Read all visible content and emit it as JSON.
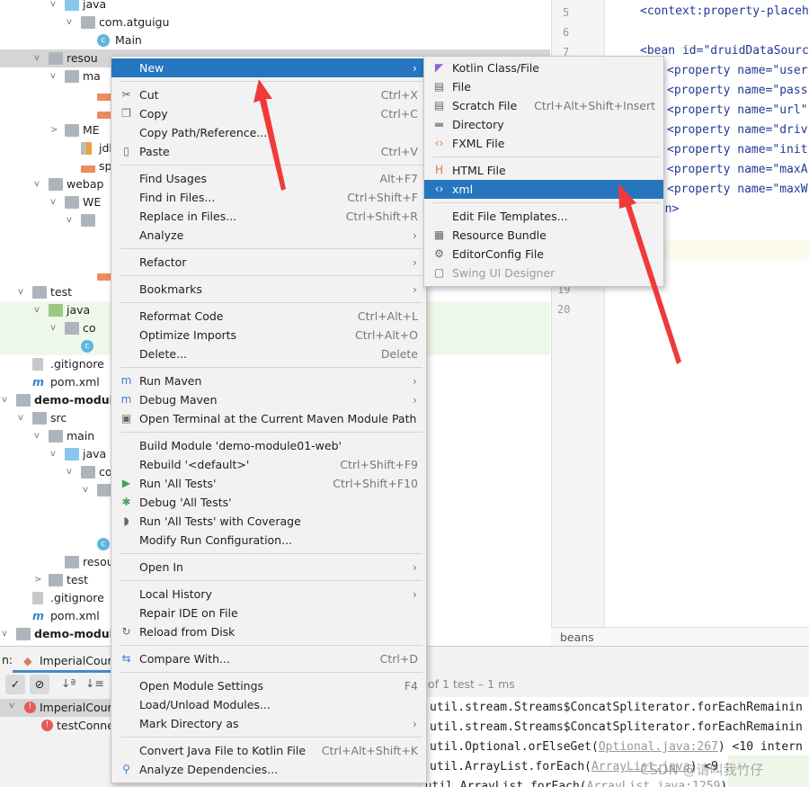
{
  "tree": [
    {
      "label": "java",
      "depth": 3,
      "open": true,
      "icon": "java-folder-icon"
    },
    {
      "label": "com.atguigu",
      "depth": 4,
      "open": true,
      "icon": "package-icon"
    },
    {
      "label": "Main",
      "depth": 5,
      "icon": "java-class-icon"
    },
    {
      "label": "resou",
      "depth": 2,
      "open": true,
      "icon": "resources-folder-icon",
      "selected": true
    },
    {
      "label": "ma",
      "depth": 3,
      "open": true,
      "icon": "folder-icon"
    },
    {
      "label": "",
      "depth": 5,
      "icon": "xml-file-icon"
    },
    {
      "label": "",
      "depth": 5,
      "icon": "xml-file-icon"
    },
    {
      "label": "ME",
      "depth": 3,
      "open": false,
      "icon": "folder-icon"
    },
    {
      "label": "jdb",
      "depth": 4,
      "icon": "properties-file-icon"
    },
    {
      "label": "sp",
      "depth": 4,
      "icon": "xml-file-icon"
    },
    {
      "label": "webap",
      "depth": 2,
      "open": true,
      "icon": "folder-icon"
    },
    {
      "label": "WE",
      "depth": 3,
      "open": true,
      "icon": "folder-icon"
    },
    {
      "label": "",
      "depth": 4,
      "open": true,
      "icon": "folder-icon"
    },
    null,
    null,
    {
      "label": "",
      "depth": 5,
      "icon": "xml-file-icon"
    },
    {
      "label": "test",
      "depth": 1,
      "open": true,
      "icon": "folder-icon"
    },
    {
      "label": "java",
      "depth": 2,
      "open": true,
      "icon": "test-folder-icon",
      "green": true
    },
    {
      "label": "co",
      "depth": 3,
      "open": true,
      "icon": "package-icon",
      "green": true
    },
    {
      "label": "",
      "depth": 4,
      "icon": "java-class-icon",
      "green": true
    },
    {
      "label": ".gitignore",
      "depth": 1,
      "icon": "gitignore-icon"
    },
    {
      "label": "pom.xml",
      "depth": 1,
      "icon": "maven-icon"
    },
    {
      "label": "demo-module",
      "depth": 0,
      "open": true,
      "icon": "module-icon",
      "bold": true
    },
    {
      "label": "src",
      "depth": 1,
      "open": true,
      "icon": "folder-icon"
    },
    {
      "label": "main",
      "depth": 2,
      "open": true,
      "icon": "folder-icon"
    },
    {
      "label": "java",
      "depth": 3,
      "open": true,
      "icon": "java-folder-icon"
    },
    {
      "label": "co",
      "depth": 4,
      "open": true,
      "icon": "package-icon"
    },
    {
      "label": "",
      "depth": 5,
      "open": true,
      "icon": "package-icon"
    },
    null,
    null,
    {
      "label": "",
      "depth": 5,
      "icon": "java-class-icon"
    },
    {
      "label": "resou",
      "depth": 3,
      "icon": "resources-folder-icon"
    },
    {
      "label": "test",
      "depth": 2,
      "open": false,
      "icon": "folder-icon"
    },
    {
      "label": ".gitignore",
      "depth": 1,
      "icon": "gitignore-icon"
    },
    {
      "label": "pom.xml",
      "depth": 1,
      "icon": "maven-icon"
    },
    {
      "label": "demo-module",
      "depth": 0,
      "open": true,
      "icon": "module-icon",
      "bold": true
    }
  ],
  "editor": {
    "line_numbers": [
      "5",
      "6",
      "7",
      "19",
      "20"
    ],
    "lines": [
      {
        "text": "<context:property-placeh"
      },
      {
        "text": "<bean id=\"druidDataSourc"
      },
      {
        "text": "<property name=\"user"
      },
      {
        "text": "<property name=\"pass"
      },
      {
        "text": "<property name=\"url\""
      },
      {
        "text": "<property name=\"driv"
      },
      {
        "text": "<property name=\"init"
      },
      {
        "text": "<property name=\"maxA"
      },
      {
        "text": "<property name=\"maxW"
      },
      {
        "text": "ean>"
      },
      {
        "text": ">"
      }
    ],
    "breadcrumb": "beans"
  },
  "bottom": {
    "tab_prefix": "n:",
    "tab": "ImperialCourt",
    "summary": "of 1 test – 1 ms",
    "tests": [
      "ImperialCour",
      "testConne"
    ],
    "console": [
      {
        "code": "util.stream.Streams$ConcatSpliterator.forEachRemainin",
        "link": "",
        "rest": ""
      },
      {
        "code": "util.stream.Streams$ConcatSpliterator.forEachRemainin",
        "link": "",
        "rest": ""
      },
      {
        "code": "util.Optional.orElseGet(",
        "link": "Optional.java:267",
        "rest": ") <10 intern"
      },
      {
        "code": "util.ArrayList.forEach(",
        "link": "ArrayList.java",
        "rest": ") <9 intern"
      },
      {
        "code": "at java.util.ArrayList.forEach(",
        "link": "ArrayList.java:1259",
        "rest": ") <25 intern"
      }
    ]
  },
  "watermark": "CSDN @请叫我竹仔",
  "context_menu": [
    {
      "label": "New",
      "submenu": true,
      "highlight": true
    },
    {
      "sep": true
    },
    {
      "label": "Cut",
      "shortcut": "Ctrl+X",
      "icon": "scissors-icon"
    },
    {
      "label": "Copy",
      "shortcut": "Ctrl+C",
      "icon": "copy-icon"
    },
    {
      "label": "Copy Path/Reference..."
    },
    {
      "label": "Paste",
      "shortcut": "Ctrl+V",
      "icon": "clipboard-icon"
    },
    {
      "sep": true
    },
    {
      "label": "Find Usages",
      "shortcut": "Alt+F7"
    },
    {
      "label": "Find in Files...",
      "shortcut": "Ctrl+Shift+F"
    },
    {
      "label": "Replace in Files...",
      "shortcut": "Ctrl+Shift+R"
    },
    {
      "label": "Analyze",
      "submenu": true
    },
    {
      "sep": true
    },
    {
      "label": "Refactor",
      "submenu": true
    },
    {
      "sep": true
    },
    {
      "label": "Bookmarks",
      "submenu": true
    },
    {
      "sep": true
    },
    {
      "label": "Reformat Code",
      "shortcut": "Ctrl+Alt+L"
    },
    {
      "label": "Optimize Imports",
      "shortcut": "Ctrl+Alt+O"
    },
    {
      "label": "Delete...",
      "shortcut": "Delete"
    },
    {
      "sep": true
    },
    {
      "label": "Run Maven",
      "submenu": true,
      "icon": "maven-run-icon"
    },
    {
      "label": "Debug Maven",
      "submenu": true,
      "icon": "maven-debug-icon"
    },
    {
      "label": "Open Terminal at the Current Maven Module Path",
      "icon": "terminal-icon"
    },
    {
      "sep": true
    },
    {
      "label": "Build Module 'demo-module01-web'"
    },
    {
      "label": "Rebuild '<default>'",
      "shortcut": "Ctrl+Shift+F9"
    },
    {
      "label": "Run 'All Tests'",
      "shortcut": "Ctrl+Shift+F10",
      "icon": "run-icon"
    },
    {
      "label": "Debug 'All Tests'",
      "icon": "debug-icon"
    },
    {
      "label": "Run 'All Tests' with Coverage",
      "icon": "coverage-icon"
    },
    {
      "label": "Modify Run Configuration..."
    },
    {
      "sep": true
    },
    {
      "label": "Open In",
      "submenu": true
    },
    {
      "sep": true
    },
    {
      "label": "Local History",
      "submenu": true
    },
    {
      "label": "Repair IDE on File"
    },
    {
      "label": "Reload from Disk",
      "icon": "reload-icon"
    },
    {
      "sep": true
    },
    {
      "label": "Compare With...",
      "shortcut": "Ctrl+D",
      "icon": "compare-icon"
    },
    {
      "sep": true
    },
    {
      "label": "Open Module Settings",
      "shortcut": "F4"
    },
    {
      "label": "Load/Unload Modules..."
    },
    {
      "label": "Mark Directory as",
      "submenu": true
    },
    {
      "sep": true
    },
    {
      "label": "Convert Java File to Kotlin File",
      "shortcut": "Ctrl+Alt+Shift+K"
    },
    {
      "label": "Analyze Dependencies...",
      "icon": "analyze-dependencies-icon"
    }
  ],
  "new_submenu": [
    {
      "label": "Kotlin Class/File",
      "icon": "kotlin-icon"
    },
    {
      "label": "File",
      "icon": "file-icon"
    },
    {
      "label": "Scratch File",
      "shortcut": "Ctrl+Alt+Shift+Insert",
      "icon": "scratch-file-icon"
    },
    {
      "label": "Directory",
      "icon": "folder-icon"
    },
    {
      "label": "FXML File",
      "icon": "fxml-icon"
    },
    {
      "sep": true
    },
    {
      "label": "HTML File",
      "icon": "html-icon"
    },
    {
      "label": "xml",
      "icon": "xml-file-icon",
      "highlight": true
    },
    {
      "sep": true
    },
    {
      "label": "Edit File Templates..."
    },
    {
      "label": "Resource Bundle",
      "icon": "resource-bundle-icon"
    },
    {
      "label": "EditorConfig File",
      "icon": "gear-icon"
    },
    {
      "label": "Swing UI Designer",
      "disabled": true,
      "icon": "swing-icon"
    }
  ],
  "colors": {
    "highlight": "#2675bf",
    "arrow": "#f03a3a",
    "menu_bg": "#f2f2f2",
    "test_green": "#eef8e9"
  }
}
